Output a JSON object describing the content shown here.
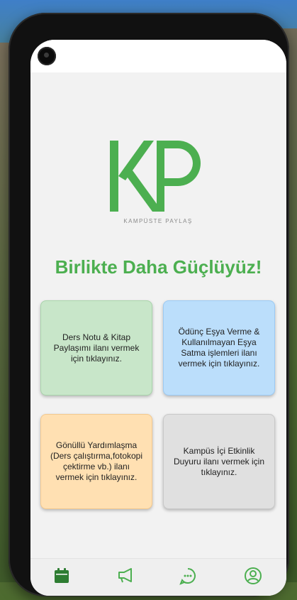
{
  "brand": {
    "logo_letters": "KP",
    "logo_caption": "KAMPÜSTE PAYLAŞ",
    "accent_color": "#4caf50"
  },
  "headline": "Birlikte Daha Güçlüyüz!",
  "cards": [
    {
      "text": "Ders Notu & Kitap Paylaşımı ilanı vermek için tıklayınız.",
      "color": "#c8e6c9"
    },
    {
      "text": "Ödünç Eşya Verme & Kullanılmayan Eşya Satma işlemleri ilanı vermek için tıklayınız.",
      "color": "#bbdefb"
    },
    {
      "text": "Gönüllü Yardımlaşma (Ders çalıştırma,fotokopi çektirme vb.) ilanı vermek için tıklayınız.",
      "color": "#ffe0b2"
    },
    {
      "text": "Kampüs İçi Etkinlik Duyuru ilanı vermek için tıklayınız.",
      "color": "#e0e0e0"
    }
  ],
  "bottom_nav": [
    {
      "icon": "calendar-icon",
      "active": true
    },
    {
      "icon": "megaphone-icon",
      "active": false
    },
    {
      "icon": "chat-bubble-icon",
      "active": false
    },
    {
      "icon": "user-circle-icon",
      "active": false
    }
  ]
}
